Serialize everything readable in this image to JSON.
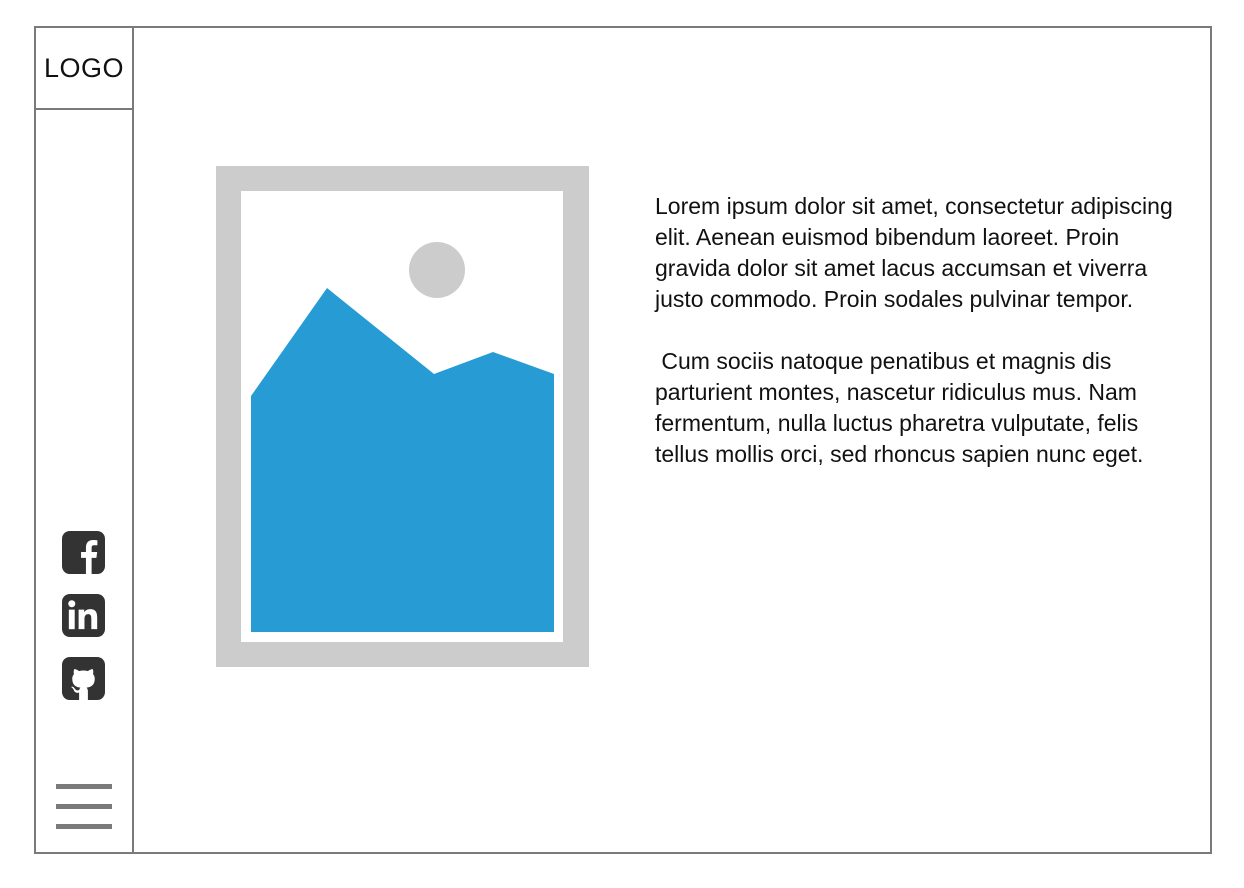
{
  "sidebar": {
    "logo_text": "LOGO",
    "social_links": [
      {
        "icon": "facebook-icon"
      },
      {
        "icon": "linkedin-icon"
      },
      {
        "icon": "github-icon"
      }
    ],
    "menu_icon": "hamburger-menu-icon"
  },
  "main": {
    "image": {
      "icon": "image-placeholder-icon",
      "colors": {
        "frame": "#cccccc",
        "mountain": "#269bd4",
        "sun": "#cccccc"
      }
    },
    "paragraphs": [
      "Lorem ipsum dolor sit amet, consectetur adipiscing elit. Aenean euismod bibendum laoreet. Proin gravida dolor sit amet lacus accumsan et viverra justo commodo. Proin sodales pulvinar tempor.",
      " Cum sociis natoque penatibus et magnis dis parturient montes, nascetur ridiculus mus. Nam fermentum, nulla luctus pharetra vulputate, felis tellus mollis orci, sed rhoncus sapien nunc eget."
    ]
  },
  "colors": {
    "border": "#7a7a7a",
    "icon": "#333333",
    "text": "#111111"
  }
}
